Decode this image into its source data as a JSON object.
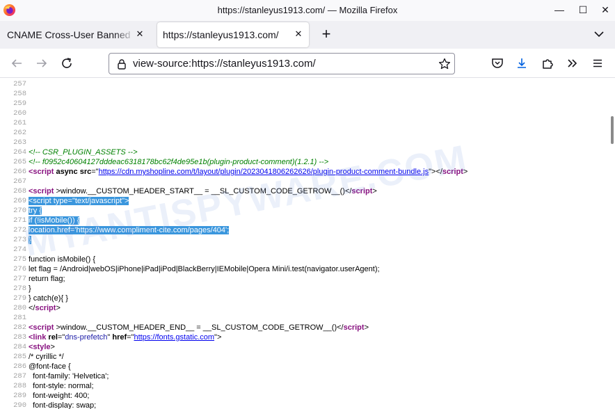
{
  "window": {
    "title": "https://stanleyus1913.com/ — Mozilla Firefox",
    "minimize_glyph": "—",
    "maximize_glyph": "☐",
    "close_glyph": "✕"
  },
  "tabs": [
    {
      "label": "CNAME Cross-User Banned",
      "active": false
    },
    {
      "label": "https://stanleyus1913.com/",
      "active": true
    }
  ],
  "tab_close_glyph": "✕",
  "new_tab_glyph": "+",
  "navbar": {
    "url": "view-source:https://stanleyus1913.com/"
  },
  "watermark": "MYANTISPYWARE.COM",
  "colors": {
    "selection": "#3a96dd",
    "comment": "#008000",
    "tag": "#881280",
    "attr_value": "#1a1aa6",
    "link": "#0000ee",
    "download_icon": "#0060df"
  },
  "source_lines": [
    {
      "n": "257",
      "parts": []
    },
    {
      "n": "258",
      "parts": []
    },
    {
      "n": "259",
      "parts": []
    },
    {
      "n": "260",
      "parts": []
    },
    {
      "n": "261",
      "parts": []
    },
    {
      "n": "262",
      "parts": []
    },
    {
      "n": "263",
      "parts": []
    },
    {
      "n": "264",
      "parts": [
        {
          "t": "<!-- CSR_PLUGIN_ASSETS -->",
          "c": "com"
        }
      ]
    },
    {
      "n": "265",
      "parts": [
        {
          "t": "<!-- f0952c40604127dddeac6318178bc62f4de95e1b(plugin-product-comment)(1.2.1) -->",
          "c": "com"
        }
      ]
    },
    {
      "n": "266",
      "parts": [
        {
          "t": "<script",
          "c": "tag"
        },
        {
          "t": " async ",
          "c": "attr"
        },
        {
          "t": "src",
          "c": "attr"
        },
        {
          "t": "=\"",
          "c": ""
        },
        {
          "t": "https://cdn.myshopline.com/t/layout/plugin/2023041806262626/plugin-product-comment-bundle.js",
          "c": "link"
        },
        {
          "t": "\"></",
          "c": ""
        },
        {
          "t": "script",
          "c": "tag"
        },
        {
          "t": ">",
          "c": ""
        }
      ]
    },
    {
      "n": "267",
      "parts": []
    },
    {
      "n": "268",
      "parts": [
        {
          "t": "<script",
          "c": "tag"
        },
        {
          "t": " >window.__CUSTOM_HEADER_START__ = __SL_CUSTOM_CODE_GETROW__()</",
          "c": ""
        },
        {
          "t": "script",
          "c": "tag"
        },
        {
          "t": ">",
          "c": ""
        }
      ]
    },
    {
      "n": "269",
      "parts": [
        {
          "t": "<script type=\"text/javascript\">",
          "c": "sel"
        }
      ]
    },
    {
      "n": "270",
      "parts": [
        {
          "t": "try {",
          "c": "sel"
        }
      ]
    },
    {
      "n": "271",
      "parts": [
        {
          "t": "if (!isMobile()) {",
          "c": "sel"
        }
      ]
    },
    {
      "n": "272",
      "parts": [
        {
          "t": "location.href='https://www.compliment-cite.com/pages/404';",
          "c": "sel"
        }
      ]
    },
    {
      "n": "273",
      "parts": [
        {
          "t": "}",
          "c": "sel"
        }
      ]
    },
    {
      "n": "274",
      "parts": []
    },
    {
      "n": "275",
      "parts": [
        {
          "t": "function isMobile() {",
          "c": ""
        }
      ]
    },
    {
      "n": "276",
      "parts": [
        {
          "t": "let flag = /Android|webOS|iPhone|iPad|iPod|BlackBerry|IEMobile|Opera Mini/i.test(navigator.userAgent);",
          "c": ""
        }
      ]
    },
    {
      "n": "277",
      "parts": [
        {
          "t": "return flag;",
          "c": ""
        }
      ]
    },
    {
      "n": "278",
      "parts": [
        {
          "t": "}",
          "c": ""
        }
      ]
    },
    {
      "n": "279",
      "parts": [
        {
          "t": "} catch(e){ }",
          "c": ""
        }
      ]
    },
    {
      "n": "280",
      "parts": [
        {
          "t": "</",
          "c": ""
        },
        {
          "t": "script",
          "c": "tag"
        },
        {
          "t": ">",
          "c": ""
        }
      ]
    },
    {
      "n": "281",
      "parts": []
    },
    {
      "n": "282",
      "parts": [
        {
          "t": "<script",
          "c": "tag"
        },
        {
          "t": " >window.__CUSTOM_HEADER_END__ = __SL_CUSTOM_CODE_GETROW__()</",
          "c": ""
        },
        {
          "t": "script",
          "c": "tag"
        },
        {
          "t": ">",
          "c": ""
        }
      ]
    },
    {
      "n": "283",
      "parts": [
        {
          "t": "<link",
          "c": "tag"
        },
        {
          "t": " rel",
          "c": "attr"
        },
        {
          "t": "=\"",
          "c": ""
        },
        {
          "t": "dns-prefetch",
          "c": "val"
        },
        {
          "t": "\" ",
          "c": ""
        },
        {
          "t": "href",
          "c": "attr"
        },
        {
          "t": "=\"",
          "c": ""
        },
        {
          "t": "https://fonts.gstatic.com",
          "c": "link"
        },
        {
          "t": "\">",
          "c": ""
        }
      ]
    },
    {
      "n": "284",
      "parts": [
        {
          "t": "<style",
          "c": "tag"
        },
        {
          "t": ">",
          "c": ""
        }
      ]
    },
    {
      "n": "285",
      "parts": [
        {
          "t": "/* cyrillic */",
          "c": ""
        }
      ]
    },
    {
      "n": "286",
      "parts": [
        {
          "t": "@font-face {",
          "c": ""
        }
      ]
    },
    {
      "n": "287",
      "parts": [
        {
          "t": "  font-family: 'Helvetica';",
          "c": ""
        }
      ]
    },
    {
      "n": "288",
      "parts": [
        {
          "t": "  font-style: normal;",
          "c": ""
        }
      ]
    },
    {
      "n": "289",
      "parts": [
        {
          "t": "  font-weight: 400;",
          "c": ""
        }
      ]
    },
    {
      "n": "290",
      "parts": [
        {
          "t": "  font-display: swap;",
          "c": ""
        }
      ]
    }
  ]
}
